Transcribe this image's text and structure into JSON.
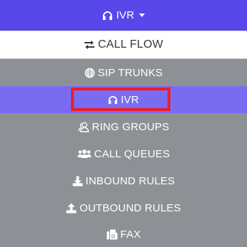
{
  "dropdown": {
    "toggle_label": "IVR",
    "toggle_icon": "headphones-icon"
  },
  "menu": {
    "items": [
      {
        "label": "CALL FLOW",
        "icon": "exchange-arrows-icon",
        "state": "highlighted"
      },
      {
        "label": "SIP TRUNKS",
        "icon": "globe-icon",
        "state": "normal"
      },
      {
        "label": "IVR",
        "icon": "headphones-icon",
        "state": "selected"
      },
      {
        "label": "RING GROUPS",
        "icon": "user-group-outline-icon",
        "state": "normal"
      },
      {
        "label": "CALL QUEUES",
        "icon": "users-icon",
        "state": "normal"
      },
      {
        "label": "INBOUND RULES",
        "icon": "download-icon",
        "state": "normal"
      },
      {
        "label": "OUTBOUND RULES",
        "icon": "upload-icon",
        "state": "normal"
      },
      {
        "label": "FAX",
        "icon": "fax-icon",
        "state": "normal"
      }
    ]
  },
  "colors": {
    "accent": "#5948e9",
    "selected": "#7a6cf0",
    "menu_bg": "#8d9196",
    "highlight_border": "#ee1c25"
  }
}
